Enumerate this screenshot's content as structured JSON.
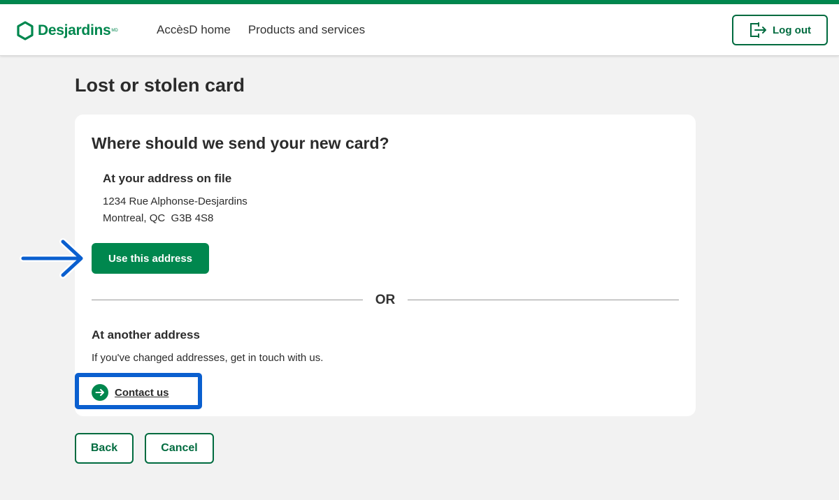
{
  "colors": {
    "brand_green": "#00874e",
    "dark_green": "#006b3f",
    "highlight_blue": "#0a5fcf",
    "background": "#f2f2f2"
  },
  "header": {
    "logo_text": "Desjardins",
    "logo_mark": "MD",
    "nav": [
      "AccèsD home",
      "Products and services"
    ],
    "logout_label": "Log out",
    "logout_icon": "exit-door-icon"
  },
  "page": {
    "title": "Lost or stolen card"
  },
  "card": {
    "title": "Where should we send your new card?",
    "address_on_file": {
      "title": "At your address on file",
      "line1": "1234 Rue Alphonse-Desjardins",
      "line2": "Montreal, QC  G3B 4S8",
      "button_label": "Use this address"
    },
    "divider_label": "OR",
    "other_address": {
      "title": "At another address",
      "description": "If you've changed addresses, get in touch with us.",
      "link_label": "Contact us",
      "link_icon": "arrow-circle-right-icon"
    }
  },
  "footer_buttons": {
    "back_label": "Back",
    "cancel_label": "Cancel"
  }
}
